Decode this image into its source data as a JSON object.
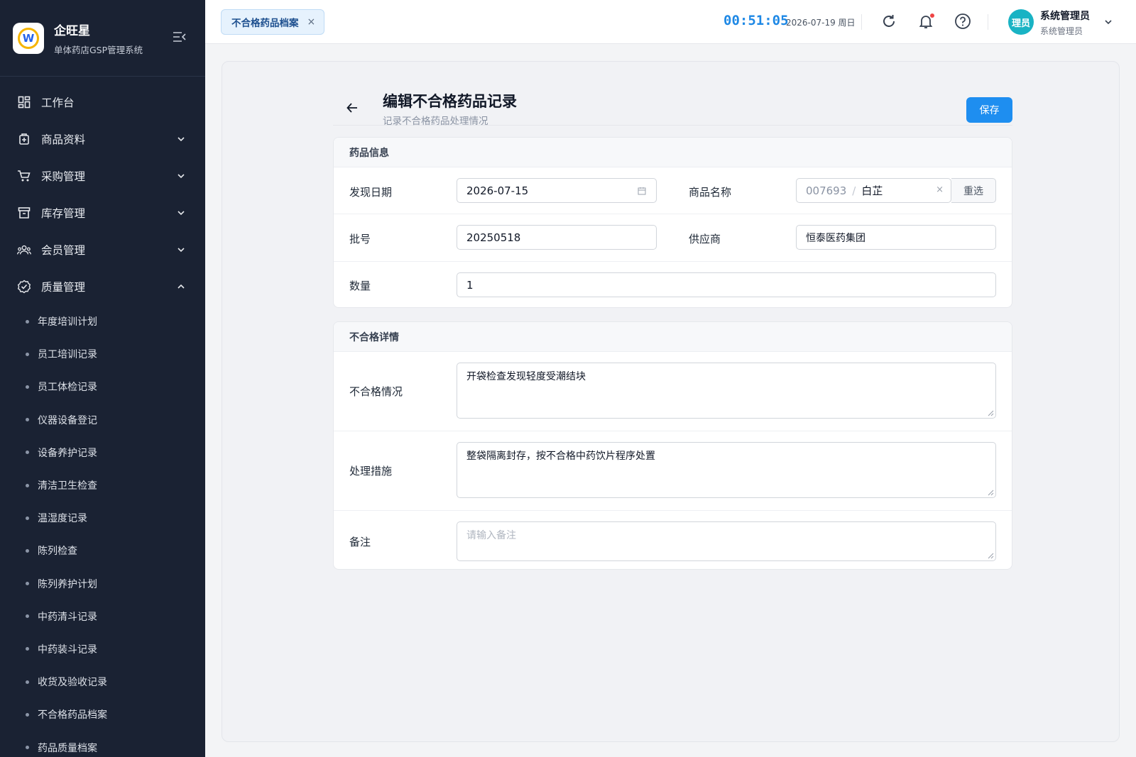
{
  "brand": {
    "name": "企旺星",
    "subtitle": "单体药店GSP管理系统",
    "logo_letter": "W"
  },
  "sidebar": {
    "items": [
      {
        "label": "工作台",
        "icon": "dashboard-icon"
      },
      {
        "label": "商品资料",
        "icon": "medicine-box-icon"
      },
      {
        "label": "采购管理",
        "icon": "cart-icon"
      },
      {
        "label": "库存管理",
        "icon": "archive-icon"
      },
      {
        "label": "会员管理",
        "icon": "users-icon"
      },
      {
        "label": "质量管理",
        "icon": "badge-check-icon"
      }
    ],
    "quality_sub": [
      "年度培训计划",
      "员工培训记录",
      "员工体检记录",
      "仪器设备登记",
      "设备养护记录",
      "清洁卫生检查",
      "温湿度记录",
      "陈列检查",
      "陈列养护计划",
      "中药清斗记录",
      "中药装斗记录",
      "收货及验收记录",
      "不合格药品档案",
      "药品质量档案"
    ]
  },
  "topbar": {
    "tab_label": "不合格药品档案",
    "tab_close": "×",
    "clock": "00:51:05",
    "date": "2026-07-19 周日",
    "avatar_text": "理员",
    "user_name": "系统管理员",
    "user_role": "系统管理员"
  },
  "page": {
    "title": "编辑不合格药品记录",
    "subtitle": "记录不合格药品处理情况",
    "save_label": "保存"
  },
  "drug_info": {
    "section_title": "药品信息",
    "found_date_label": "发现日期",
    "found_date_value": "2026-07-15",
    "product_label": "商品名称",
    "product_code": "007693",
    "product_separator": "/",
    "product_name": "白芷",
    "clear": "×",
    "reselect_label": "重选",
    "batch_label": "批号",
    "batch_value": "20250518",
    "supplier_label": "供应商",
    "supplier_value": "恒泰医药集团",
    "quantity_label": "数量",
    "quantity_value": "1"
  },
  "details": {
    "section_title": "不合格详情",
    "situation_label": "不合格情况",
    "situation_value": "开袋检查发现轻度受潮结块",
    "measure_label": "处理措施",
    "measure_value": "整袋隔离封存，按不合格中药饮片程序处置",
    "remark_label": "备注",
    "remark_placeholder": "请输入备注"
  }
}
